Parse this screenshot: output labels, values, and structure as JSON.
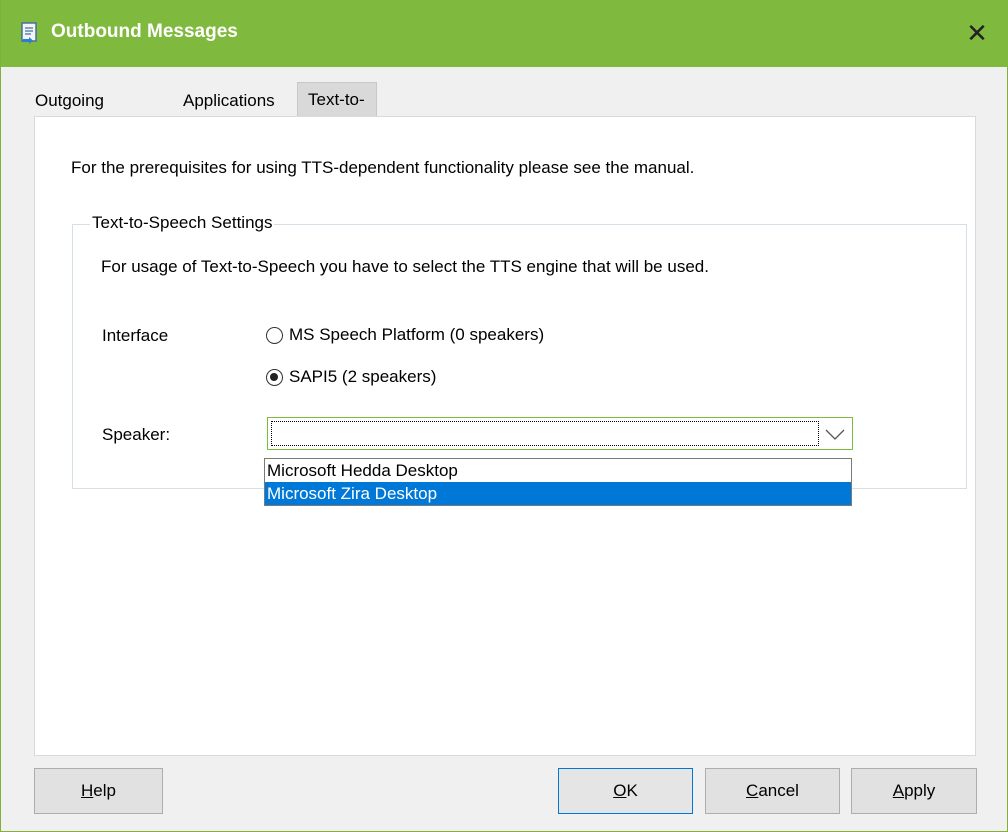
{
  "window": {
    "title": "Outbound Messages",
    "close_label": "✕"
  },
  "tabs": [
    {
      "label": "Outgoing Fax",
      "active": false
    },
    {
      "label": "Applications",
      "active": false
    },
    {
      "label": "Text-to-Speech",
      "active": true
    }
  ],
  "panel": {
    "note": "For the prerequisites for using TTS-dependent functionality please see the manual.",
    "group": {
      "legend": "Text-to-Speech Settings",
      "description": "For usage of Text-to-Speech you have to select the TTS engine that will be used.",
      "interface_label": "Interface",
      "interface_options": [
        {
          "label": "MS Speech Platform (0 speakers)",
          "checked": false
        },
        {
          "label": "SAPI5 (2 speakers)",
          "checked": true
        }
      ],
      "speaker_label": "Speaker:",
      "speaker_value": "",
      "speaker_options": [
        {
          "label": "Microsoft Hedda Desktop",
          "selected": false
        },
        {
          "label": "Microsoft Zira Desktop",
          "selected": true
        }
      ]
    }
  },
  "buttons": {
    "help": {
      "pre": "",
      "mnemonic": "H",
      "post": "elp"
    },
    "ok": {
      "pre": "",
      "mnemonic": "O",
      "post": "K"
    },
    "cancel": {
      "pre": "",
      "mnemonic": "C",
      "post": "ancel"
    },
    "apply": {
      "pre": "",
      "mnemonic": "A",
      "post": "pply"
    }
  },
  "colors": {
    "titlebar": "#7fba3e",
    "selection": "#0078d7"
  }
}
